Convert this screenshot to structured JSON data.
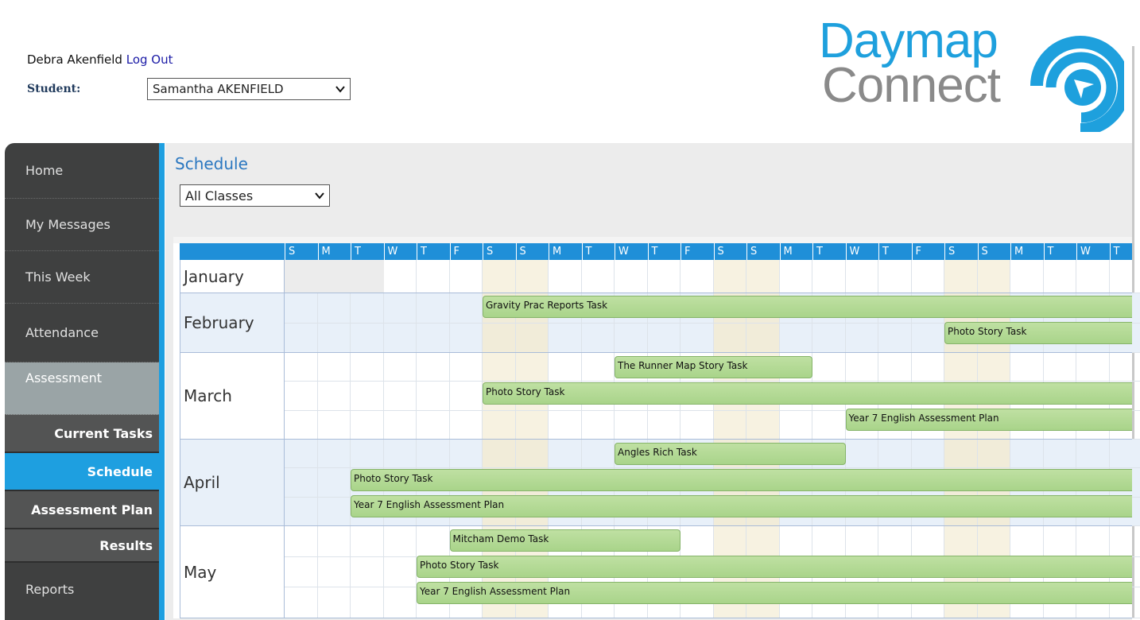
{
  "header": {
    "user_name": "Debra Akenfield",
    "logout_label": "Log Out",
    "student_label": "Student:",
    "student_selected": "Samantha AKENFIELD",
    "logo_line1": "Daymap",
    "logo_line2": "Connect"
  },
  "colors": {
    "accent_blue": "#1e9fe0",
    "sidebar_bg": "#3f4040",
    "task_green": "#a9d48a",
    "weekend_shade": "#f7f2e1",
    "header_blue": "#1f8fd8",
    "logo_grey": "#8a8a8a"
  },
  "sidebar": {
    "items": [
      {
        "label": "Home"
      },
      {
        "label": "My Messages"
      },
      {
        "label": "This Week"
      },
      {
        "label": "Attendance"
      },
      {
        "label": "Assessment"
      },
      {
        "label": "Current Tasks"
      },
      {
        "label": "Schedule",
        "selected": true
      },
      {
        "label": "Assessment Plan"
      },
      {
        "label": "Results"
      },
      {
        "label": "Reports"
      }
    ]
  },
  "main": {
    "title": "Schedule",
    "class_filter": "All Classes"
  },
  "schedule": {
    "day_headers": [
      "S",
      "M",
      "T",
      "W",
      "T",
      "F",
      "S",
      "S",
      "M",
      "T",
      "W",
      "T",
      "F",
      "S",
      "S",
      "M",
      "T",
      "W",
      "T",
      "F",
      "S",
      "S",
      "M",
      "T",
      "W",
      "T"
    ],
    "months": [
      "January",
      "February",
      "March",
      "April",
      "May"
    ],
    "tasks": [
      {
        "label": "Gravity Prac Reports Task",
        "month": "February"
      },
      {
        "label": "Photo Story Task",
        "month": "February"
      },
      {
        "label": "The Runner Map Story Task",
        "month": "March"
      },
      {
        "label": "Photo Story Task",
        "month": "March"
      },
      {
        "label": "Year 7 English Assessment Plan",
        "month": "March"
      },
      {
        "label": "Angles Rich Task",
        "month": "April"
      },
      {
        "label": "Photo Story Task",
        "month": "April"
      },
      {
        "label": "Year 7 English Assessment Plan",
        "month": "April"
      },
      {
        "label": "Mitcham Demo Task",
        "month": "May"
      },
      {
        "label": "Photo Story Task",
        "month": "May"
      },
      {
        "label": "Year 7 English Assessment Plan",
        "month": "May"
      }
    ]
  }
}
